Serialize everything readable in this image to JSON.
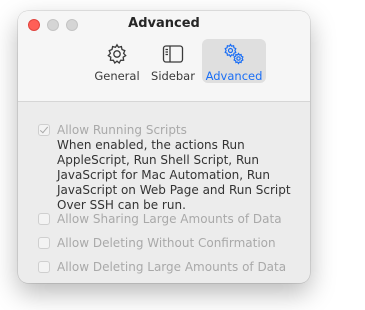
{
  "window": {
    "title": "Advanced"
  },
  "toolbar": {
    "items": [
      {
        "label": "General",
        "icon": "gear-icon",
        "selected": false
      },
      {
        "label": "Sidebar",
        "icon": "sidebar-icon",
        "selected": false
      },
      {
        "label": "Advanced",
        "icon": "gears-icon",
        "selected": true
      }
    ]
  },
  "settings": {
    "allow_running_scripts": {
      "label": "Allow Running Scripts",
      "checked": true,
      "enabled": false,
      "description": "When enabled, the actions Run AppleScript, Run Shell Script, Run JavaScript for Mac Automation, Run JavaScript on Web Page and Run Script Over SSH can be run."
    },
    "allow_sharing_large": {
      "label": "Allow Sharing Large Amounts of Data",
      "checked": false,
      "enabled": false
    },
    "allow_deleting_without_confirmation": {
      "label": "Allow Deleting Without Confirmation",
      "checked": false,
      "enabled": false
    },
    "allow_deleting_large": {
      "label": "Allow Deleting Large Amounts of Data",
      "checked": false,
      "enabled": false
    }
  },
  "colors": {
    "accent": "#1a6ef5",
    "close": "#ff5f57",
    "disabled_text": "#a9a9a9"
  }
}
